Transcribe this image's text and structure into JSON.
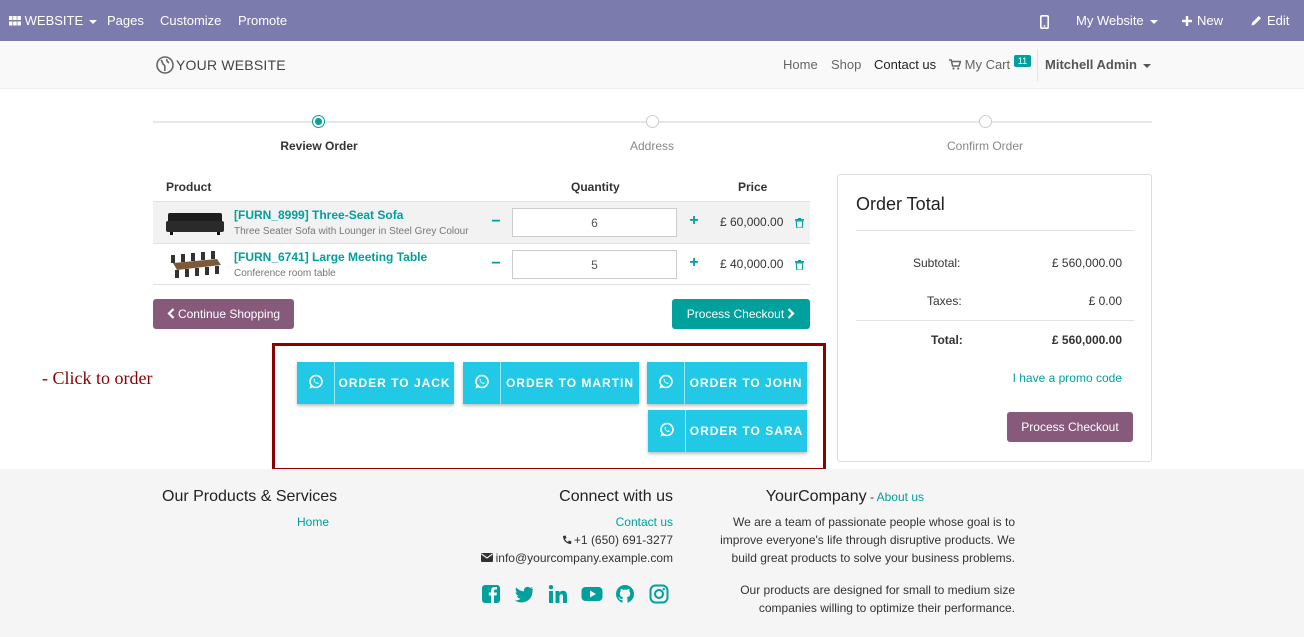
{
  "adminbar": {
    "website_label": "WEBSITE",
    "menu": [
      "Pages",
      "Customize",
      "Promote"
    ],
    "my_website_label": "My Website",
    "new_label": "New",
    "edit_label": "Edit"
  },
  "navbar": {
    "logo_text": "YOUR WEBSITE",
    "links": [
      "Home",
      "Shop",
      "Contact us"
    ],
    "cart_label": "My Cart",
    "cart_count": "11",
    "user_name": "Mitchell Admin"
  },
  "wizard": {
    "steps": [
      "Review Order",
      "Address",
      "Confirm Order"
    ],
    "active_index": 0
  },
  "cart": {
    "headers": {
      "product": "Product",
      "quantity": "Quantity",
      "price": "Price"
    },
    "rows": [
      {
        "name": "[FURN_8999] Three-Seat Sofa",
        "description": "Three Seater Sofa with Lounger in Steel Grey Colour",
        "quantity": "6",
        "price": "£ 60,000.00"
      },
      {
        "name": "[FURN_6741] Large Meeting Table",
        "description": "Conference room table",
        "quantity": "5",
        "price": "£ 40,000.00"
      }
    ],
    "continue_label": "Continue Shopping",
    "checkout_label": "Process Checkout"
  },
  "annotation": {
    "text": "- Click to order"
  },
  "whatsapp": {
    "buttons": [
      "ORDER TO JACK",
      "ORDER TO MARTIN",
      "ORDER TO JOHN",
      "ORDER TO SARA"
    ]
  },
  "order_total": {
    "title": "Order Total",
    "subtotal_label": "Subtotal:",
    "subtotal_value": "£ 560,000.00",
    "taxes_label": "Taxes:",
    "taxes_value": "£ 0.00",
    "total_label": "Total:",
    "total_value": "£ 560,000.00",
    "promo_label": "I have a promo code",
    "checkout_label": "Process Checkout"
  },
  "footer": {
    "products_title": "Our Products & Services",
    "products_link": "Home",
    "connect_title": "Connect with us",
    "contact_link": "Contact us",
    "phone": "+1 (650) 691-3277",
    "email": "info@yourcompany.example.com",
    "company_title": "YourCompany",
    "about_link": "About us",
    "about_lines": [
      "We are a team of passionate people whose goal is to",
      "improve everyone's life through disruptive products. We",
      "build great products to solve your business problems."
    ],
    "about_lines_2": [
      "Our products are designed for small to medium size",
      "companies willing to optimize their performance."
    ]
  },
  "colors": {
    "admin_bar": "#7c7bad",
    "accent": "#00a09d",
    "secondary": "#875a7b",
    "whatsapp": "#21c9e6",
    "frame": "#8b0000"
  }
}
